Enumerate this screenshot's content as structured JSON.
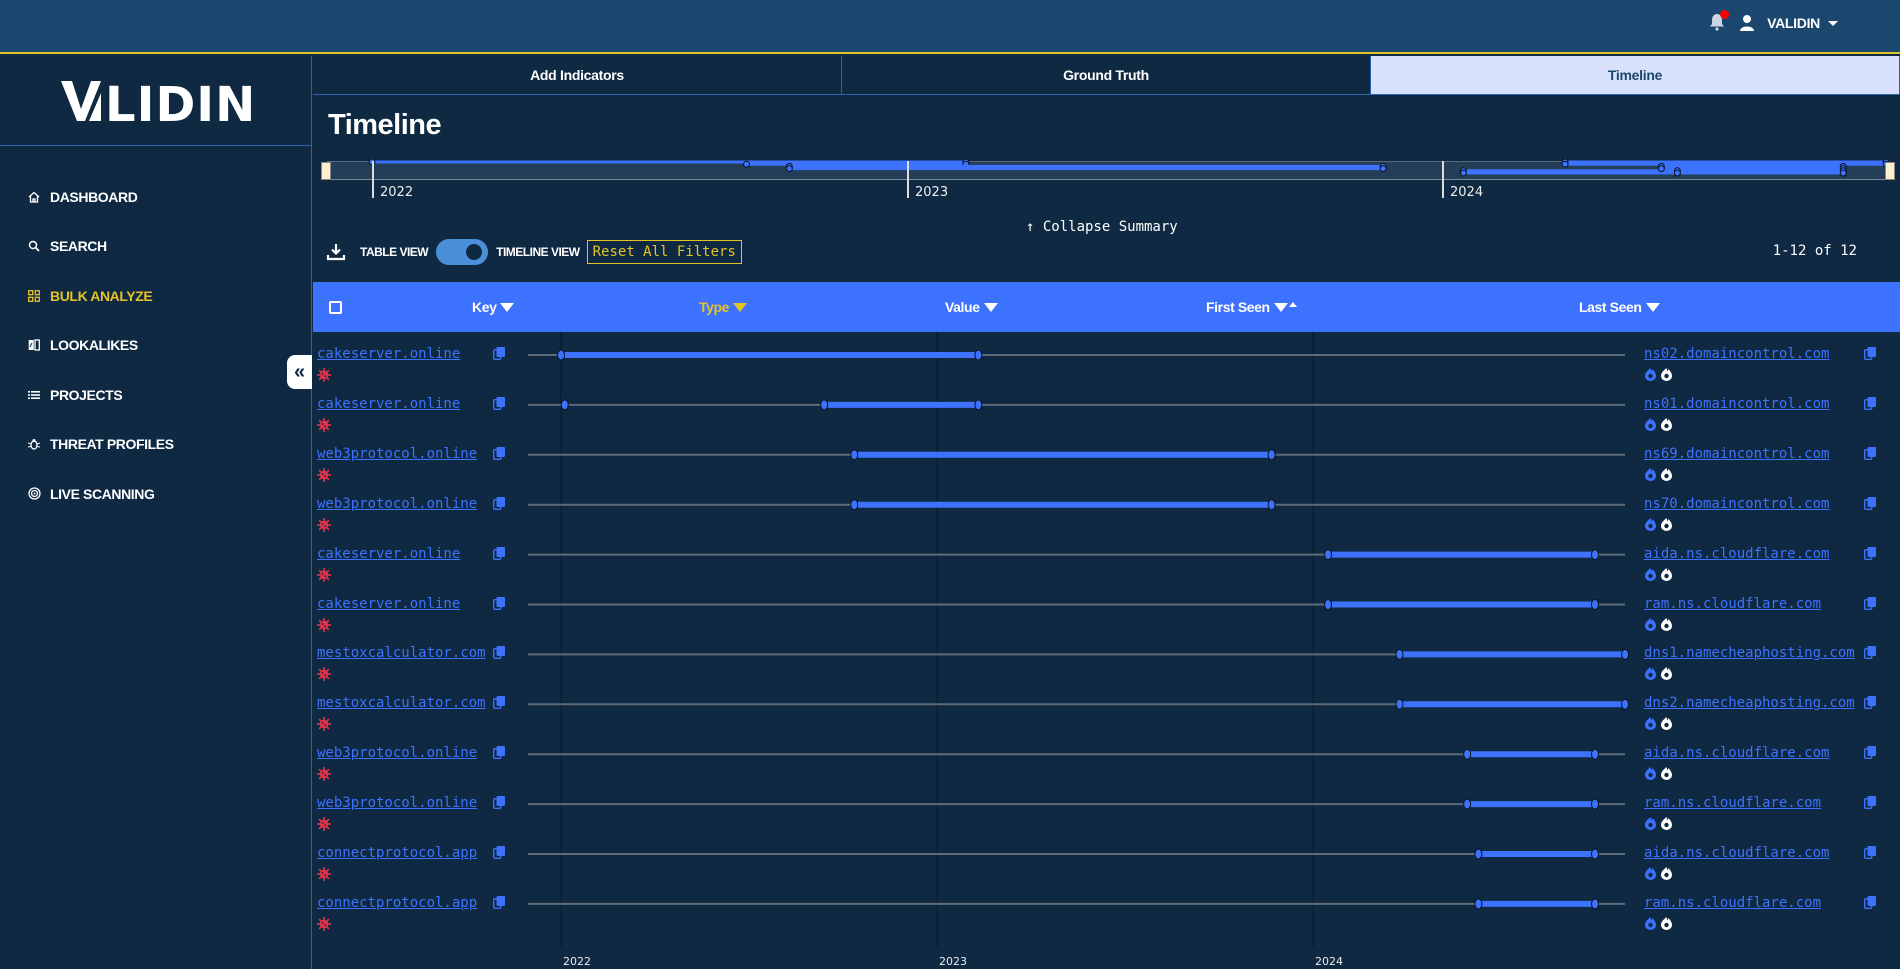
{
  "topbar": {
    "user_name": "VALIDIN",
    "notification_dot_color": "#ff0000"
  },
  "logo": {
    "text": "VALIDIN"
  },
  "sidebar": {
    "items": [
      {
        "label": "DASHBOARD",
        "icon": "home-icon",
        "active": false
      },
      {
        "label": "SEARCH",
        "icon": "search-icon",
        "active": false
      },
      {
        "label": "BULK ANALYZE",
        "icon": "grid-icon",
        "active": true
      },
      {
        "label": "LOOKALIKES",
        "icon": "lookalikes-icon",
        "active": false
      },
      {
        "label": "PROJECTS",
        "icon": "list-icon",
        "active": false
      },
      {
        "label": "THREAT PROFILES",
        "icon": "bug-icon",
        "active": false
      },
      {
        "label": "LIVE SCANNING",
        "icon": "radar-icon",
        "active": false
      }
    ],
    "collapse_glyph": "«"
  },
  "tabs": [
    {
      "label": "Add Indicators",
      "active": false
    },
    {
      "label": "Ground Truth",
      "active": false
    },
    {
      "label": "Timeline",
      "active": true
    }
  ],
  "page": {
    "title": "Timeline"
  },
  "summary": {
    "years": [
      "2022",
      "2023",
      "2024"
    ],
    "collapse_label": "↑ Collapse Summary"
  },
  "toolbar": {
    "table_view_label": "TABLE VIEW",
    "timeline_view_label": "TIMELINE VIEW",
    "toggle_state": "timeline",
    "reset_label": "Reset All Filters",
    "pagination": "1-12 of 12"
  },
  "table": {
    "columns": [
      {
        "label": "Key",
        "filter": true,
        "highlighted": false
      },
      {
        "label": "Type",
        "filter": true,
        "highlighted": true
      },
      {
        "label": "Value",
        "filter": true,
        "highlighted": false
      },
      {
        "label": "First Seen",
        "filter": true,
        "highlighted": false,
        "sort": "ascending"
      },
      {
        "label": "Last Seen",
        "filter": true,
        "highlighted": false
      }
    ],
    "axis_years": [
      "2022",
      "2023",
      "2024"
    ],
    "rows": [
      {
        "key": "cakeserver.online",
        "value": "ns02.domaincontrol.com",
        "first_seen": 2022.0,
        "last_seen": 2023.11,
        "extra_point": null
      },
      {
        "key": "cakeserver.online",
        "value": "ns01.domaincontrol.com",
        "first_seen": 2022.7,
        "last_seen": 2023.11,
        "extra_point": 2022.01
      },
      {
        "key": "web3protocol.online",
        "value": "ns69.domaincontrol.com",
        "first_seen": 2022.78,
        "last_seen": 2023.89,
        "extra_point": null
      },
      {
        "key": "web3protocol.online",
        "value": "ns70.domaincontrol.com",
        "first_seen": 2022.78,
        "last_seen": 2023.89,
        "extra_point": null
      },
      {
        "key": "cakeserver.online",
        "value": "aida.ns.cloudflare.com",
        "first_seen": 2024.04,
        "last_seen": 2024.75,
        "extra_point": null
      },
      {
        "key": "cakeserver.online",
        "value": "ram.ns.cloudflare.com",
        "first_seen": 2024.04,
        "last_seen": 2024.75,
        "extra_point": null
      },
      {
        "key": "mestoxcalculator.com",
        "value": "dns1.namecheaphosting.com",
        "first_seen": 2024.23,
        "last_seen": 2024.83,
        "extra_point": null
      },
      {
        "key": "mestoxcalculator.com",
        "value": "dns2.namecheaphosting.com",
        "first_seen": 2024.23,
        "last_seen": 2024.83,
        "extra_point": null
      },
      {
        "key": "web3protocol.online",
        "value": "aida.ns.cloudflare.com",
        "first_seen": 2024.41,
        "last_seen": 2024.75,
        "extra_point": null
      },
      {
        "key": "web3protocol.online",
        "value": "ram.ns.cloudflare.com",
        "first_seen": 2024.41,
        "last_seen": 2024.75,
        "extra_point": null
      },
      {
        "key": "connectprotocol.app",
        "value": "aida.ns.cloudflare.com",
        "first_seen": 2024.44,
        "last_seen": 2024.75,
        "extra_point": null
      },
      {
        "key": "connectprotocol.app",
        "value": "ram.ns.cloudflare.com",
        "first_seen": 2024.44,
        "last_seen": 2024.75,
        "extra_point": null
      }
    ]
  },
  "colors": {
    "accent_blue": "#3d72fe",
    "accent_yellow": "#e6c229",
    "background": "#0f2942",
    "topbar": "#1b466e",
    "threat_red": "#e0344a"
  }
}
